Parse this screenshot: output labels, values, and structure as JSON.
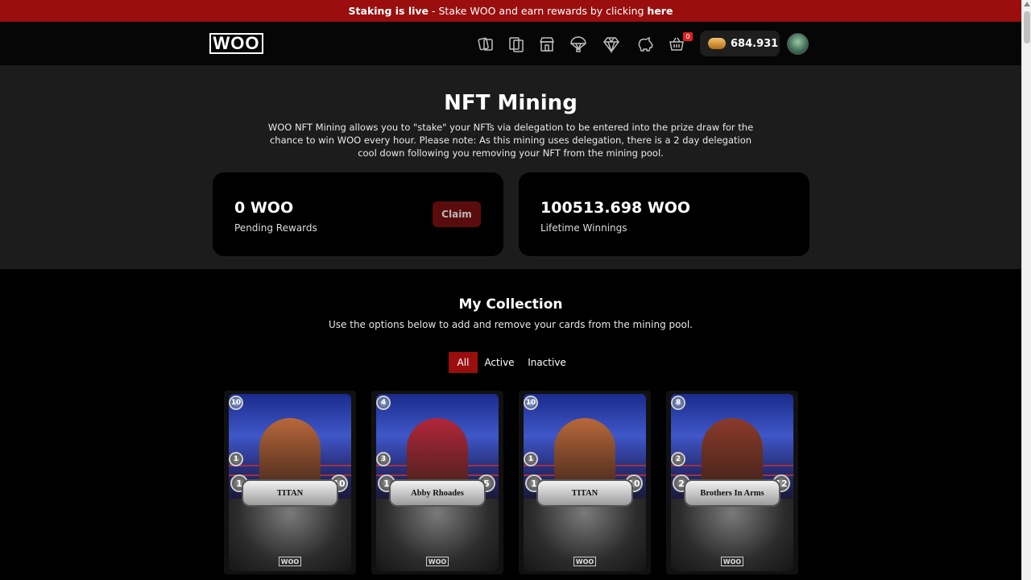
{
  "banner": {
    "bold_text": "Staking is live",
    "text": " - Stake WOO and earn rewards by clicking ",
    "link": "here"
  },
  "header": {
    "logo": "WOO",
    "nav_icons": [
      "cards-icon",
      "packs-icon",
      "market-icon",
      "airdrop-icon",
      "gem-icon",
      "piggy-bank-icon",
      "cart-icon"
    ],
    "cart_count": "0",
    "balance": "684.931"
  },
  "mining": {
    "title": "NFT Mining",
    "description": "WOO NFT Mining allows you to \"stake\" your NFTs via delegation to be entered into the prize draw for the chance to win WOO every hour. Please note: As this mining uses delegation, there is a 2 day delegation cool down following you removing your NFT from the mining pool.",
    "pending": {
      "value": "0 WOO",
      "label": "Pending Rewards",
      "button": "Claim"
    },
    "lifetime": {
      "value": "100513.698 WOO",
      "label": "Lifetime Winnings"
    }
  },
  "collection": {
    "title": "My Collection",
    "subtitle": "Use the options below to add and remove your cards from the mining pool.",
    "tabs": [
      "All",
      "Active",
      "Inactive"
    ],
    "cards": [
      {
        "name": "TITAN",
        "mana": "10",
        "speed": "1",
        "attack": "1",
        "health": "10",
        "color": "#b8683a"
      },
      {
        "name": "Abby Rhoades",
        "mana": "4",
        "speed": "3",
        "attack": "1",
        "health": "5",
        "color": "#b3263a"
      },
      {
        "name": "TITAN",
        "mana": "10",
        "speed": "1",
        "attack": "1",
        "health": "10",
        "color": "#b8683a"
      },
      {
        "name": "Brothers In Arms",
        "mana": "8",
        "speed": "2",
        "attack": "2",
        "health": "12",
        "color": "#8a3a2a"
      }
    ],
    "card_brand": "WOO"
  }
}
